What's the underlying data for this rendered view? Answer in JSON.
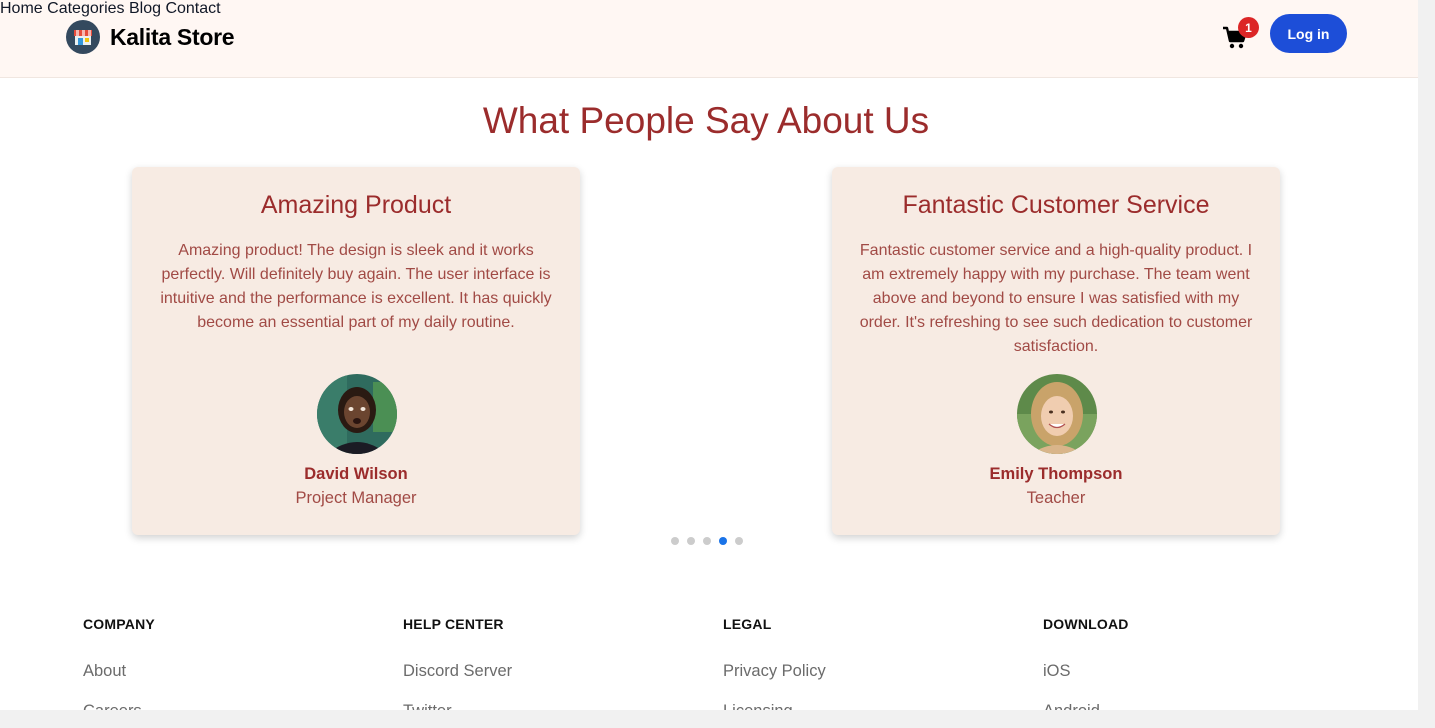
{
  "header": {
    "brand": "Kalita Store",
    "nav": [
      {
        "label": "Home"
      },
      {
        "label": "Categories"
      },
      {
        "label": "Blog"
      },
      {
        "label": "Contact"
      }
    ],
    "cart_count": "1",
    "login_label": "Log in"
  },
  "testimonials": {
    "title": "What People Say About Us",
    "cards": [
      {
        "title": "Amazing Product",
        "text": "Amazing product! The design is sleek and it works perfectly. Will definitely buy again. The user interface is intuitive and the performance is excellent. It has quickly become an essential part of my daily routine.",
        "name": "David Wilson",
        "role": "Project Manager"
      },
      {
        "title": "Fantastic Customer Service",
        "text": "Fantastic customer service and a high-quality product. I am extremely happy with my purchase. The team went above and beyond to ensure I was satisfied with my order. It's refreshing to see such dedication to customer satisfaction.",
        "name": "Emily Thompson",
        "role": "Teacher"
      }
    ],
    "carousel_dots": 5,
    "active_dot": 4
  },
  "footer": {
    "columns": [
      {
        "heading": "COMPANY",
        "links": [
          "About",
          "Careers"
        ]
      },
      {
        "heading": "HELP CENTER",
        "links": [
          "Discord Server",
          "Twitter"
        ]
      },
      {
        "heading": "LEGAL",
        "links": [
          "Privacy Policy",
          "Licensing"
        ]
      },
      {
        "heading": "DOWNLOAD",
        "links": [
          "iOS",
          "Android"
        ]
      }
    ]
  },
  "colors": {
    "accent": "#9b2c2c",
    "card_bg": "#f7ebe3",
    "header_bg": "#fff7f3",
    "login_bg": "#1d4ed8",
    "badge": "#dc2626"
  }
}
